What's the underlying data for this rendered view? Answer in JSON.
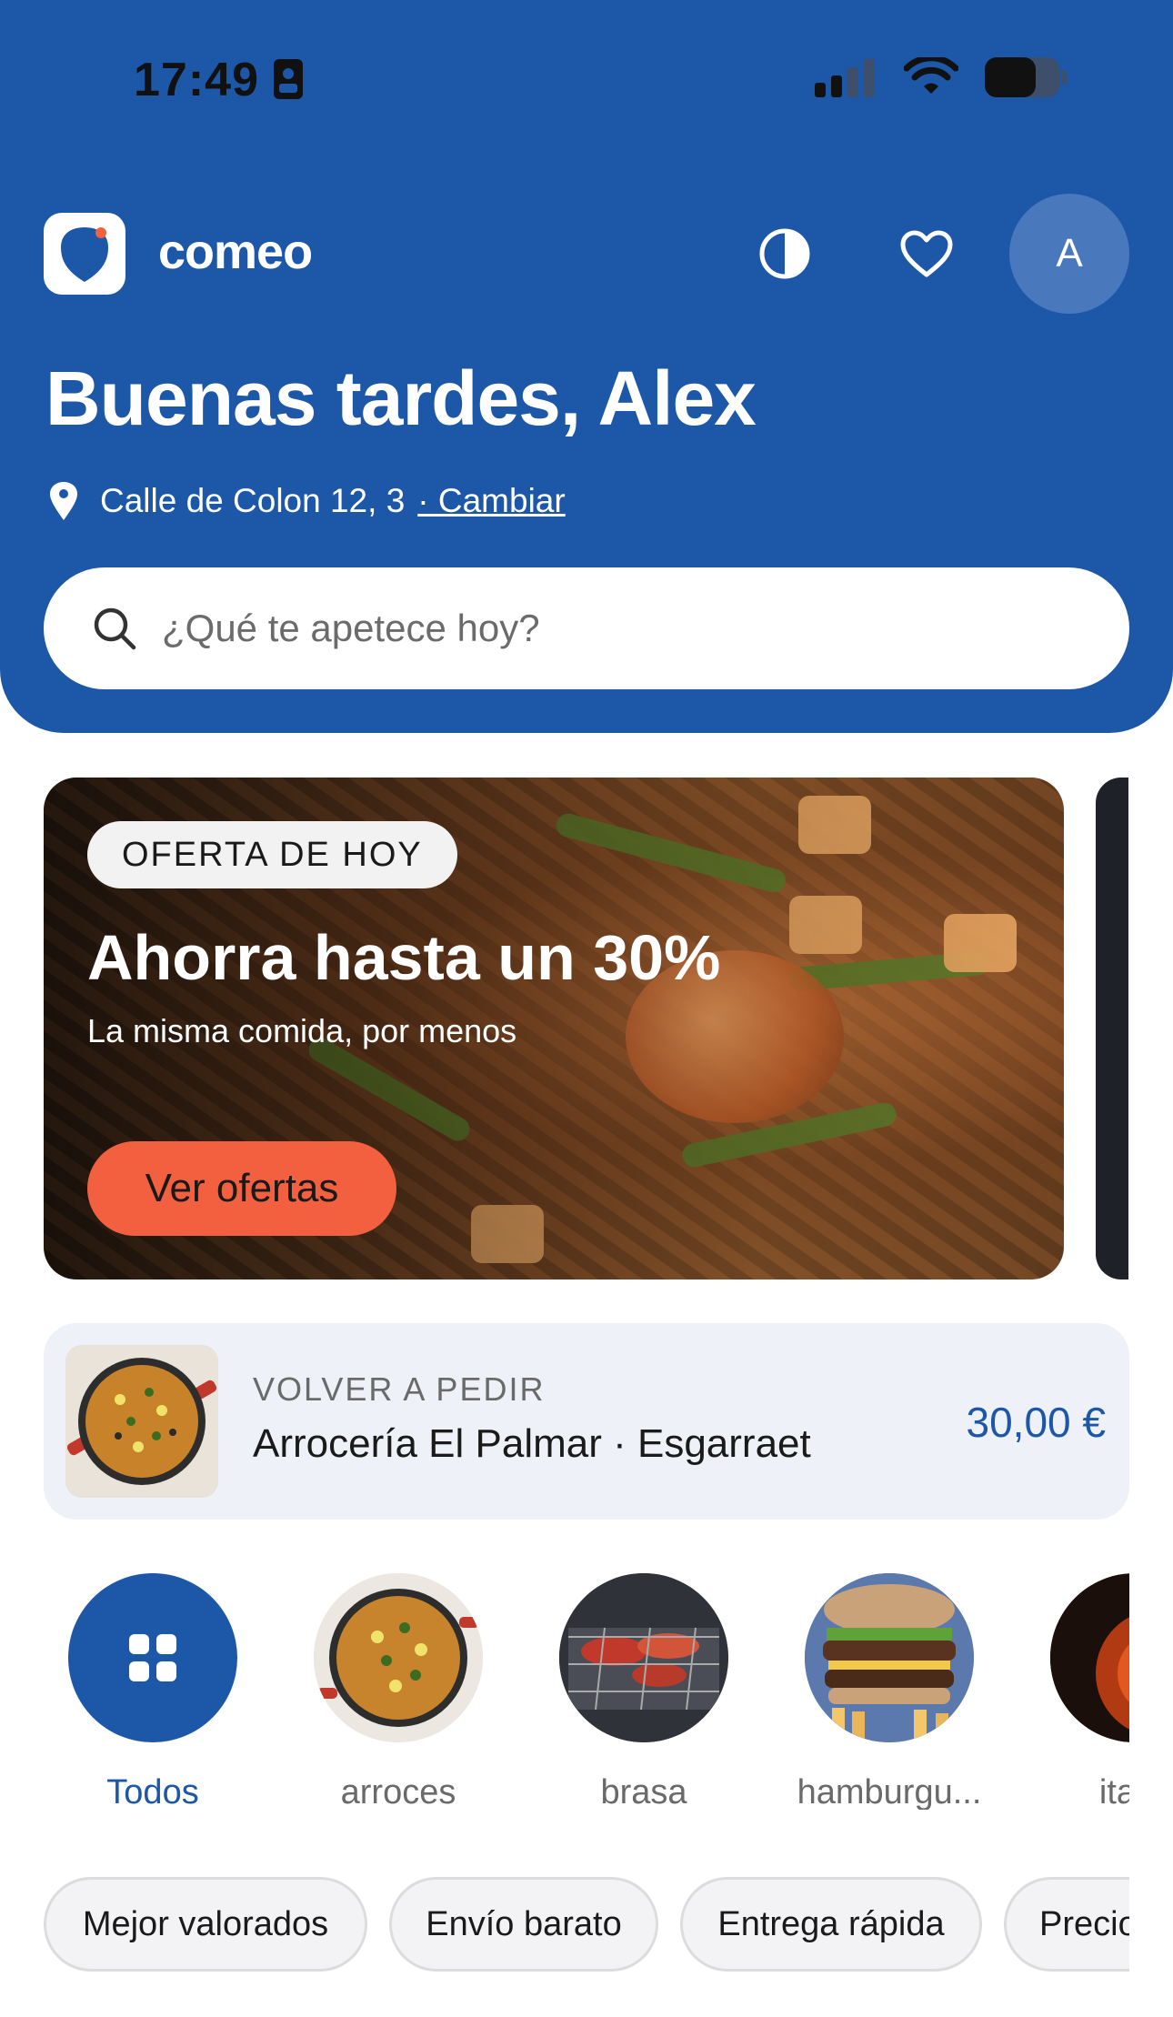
{
  "status_bar": {
    "time": "17:49"
  },
  "app": {
    "name": "comeo"
  },
  "header": {
    "avatar_initial": "A",
    "greeting": "Buenas tardes, Alex",
    "address": "Calle de Colon 12, 3",
    "change_link": "· Cambiar"
  },
  "search": {
    "placeholder": "¿Qué te apetece hoy?"
  },
  "promo": {
    "tag": "OFERTA DE HOY",
    "title": "Ahorra hasta un 30%",
    "subtitle": "La misma comida, por menos",
    "button": "Ver ofertas"
  },
  "reorder": {
    "kicker": "VOLVER A PEDIR",
    "name": "Arrocería El Palmar · Esgarraet",
    "price": "30,00 €"
  },
  "categories": [
    {
      "label": "Todos"
    },
    {
      "label": "arroces"
    },
    {
      "label": "brasa"
    },
    {
      "label": "hamburgu..."
    },
    {
      "label": "italia"
    }
  ],
  "filters": [
    {
      "label": "Mejor valorados"
    },
    {
      "label": "Envío barato"
    },
    {
      "label": "Entrega rápida"
    },
    {
      "label": "Precio"
    }
  ],
  "colors": {
    "brand": "#1d57a8",
    "accent": "#f2603f"
  }
}
